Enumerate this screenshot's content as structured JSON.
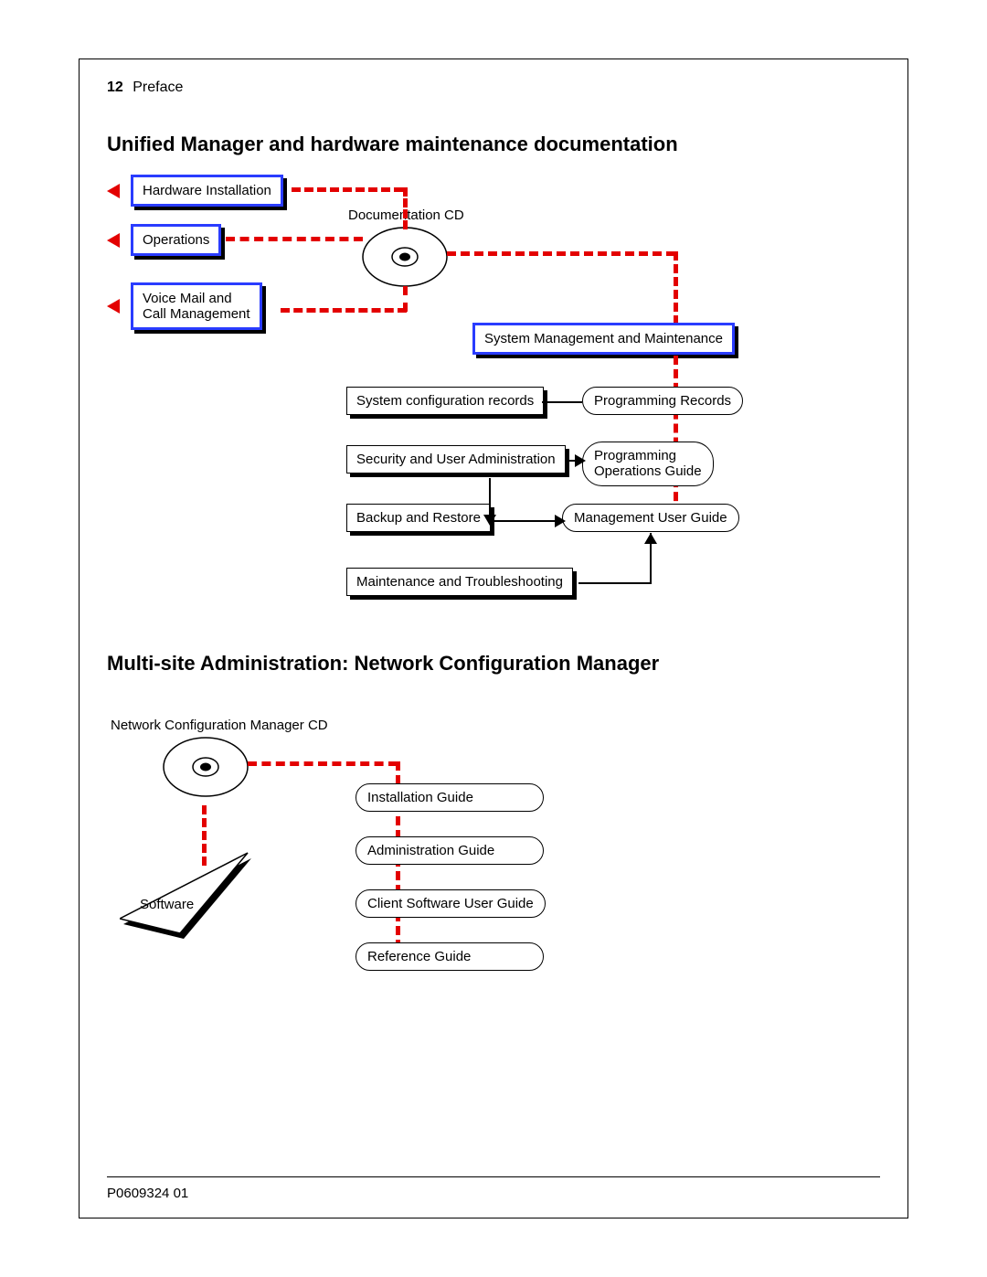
{
  "header": {
    "page_num": "12",
    "section": "Preface"
  },
  "title1": "Unified Manager and hardware maintenance documentation",
  "title2": "Multi-site Administration: Network Configuration Manager",
  "d1": {
    "hw_install": "Hardware Installation",
    "operations": "Operations",
    "voicemail": "Voice Mail and\nCall Management",
    "doc_cd": "Documentation CD",
    "sys_mgmt": "System Management and Maintenance",
    "sys_cfg": "System configuration records",
    "prog_rec": "Programming Records",
    "sec_admin": "Security and User Administration",
    "prog_ops": "Programming\nOperations Guide",
    "backup": "Backup and Restore",
    "mgmt_guide": "Management User Guide",
    "maint_trbl": "Maintenance and Troubleshooting"
  },
  "d2": {
    "ncm_cd": "Network Configuration Manager CD",
    "software": "Software",
    "install": "Installation Guide",
    "admin": "Administration Guide",
    "client": "Client Software User Guide",
    "ref": "Reference Guide"
  },
  "footer": "P0609324  01"
}
